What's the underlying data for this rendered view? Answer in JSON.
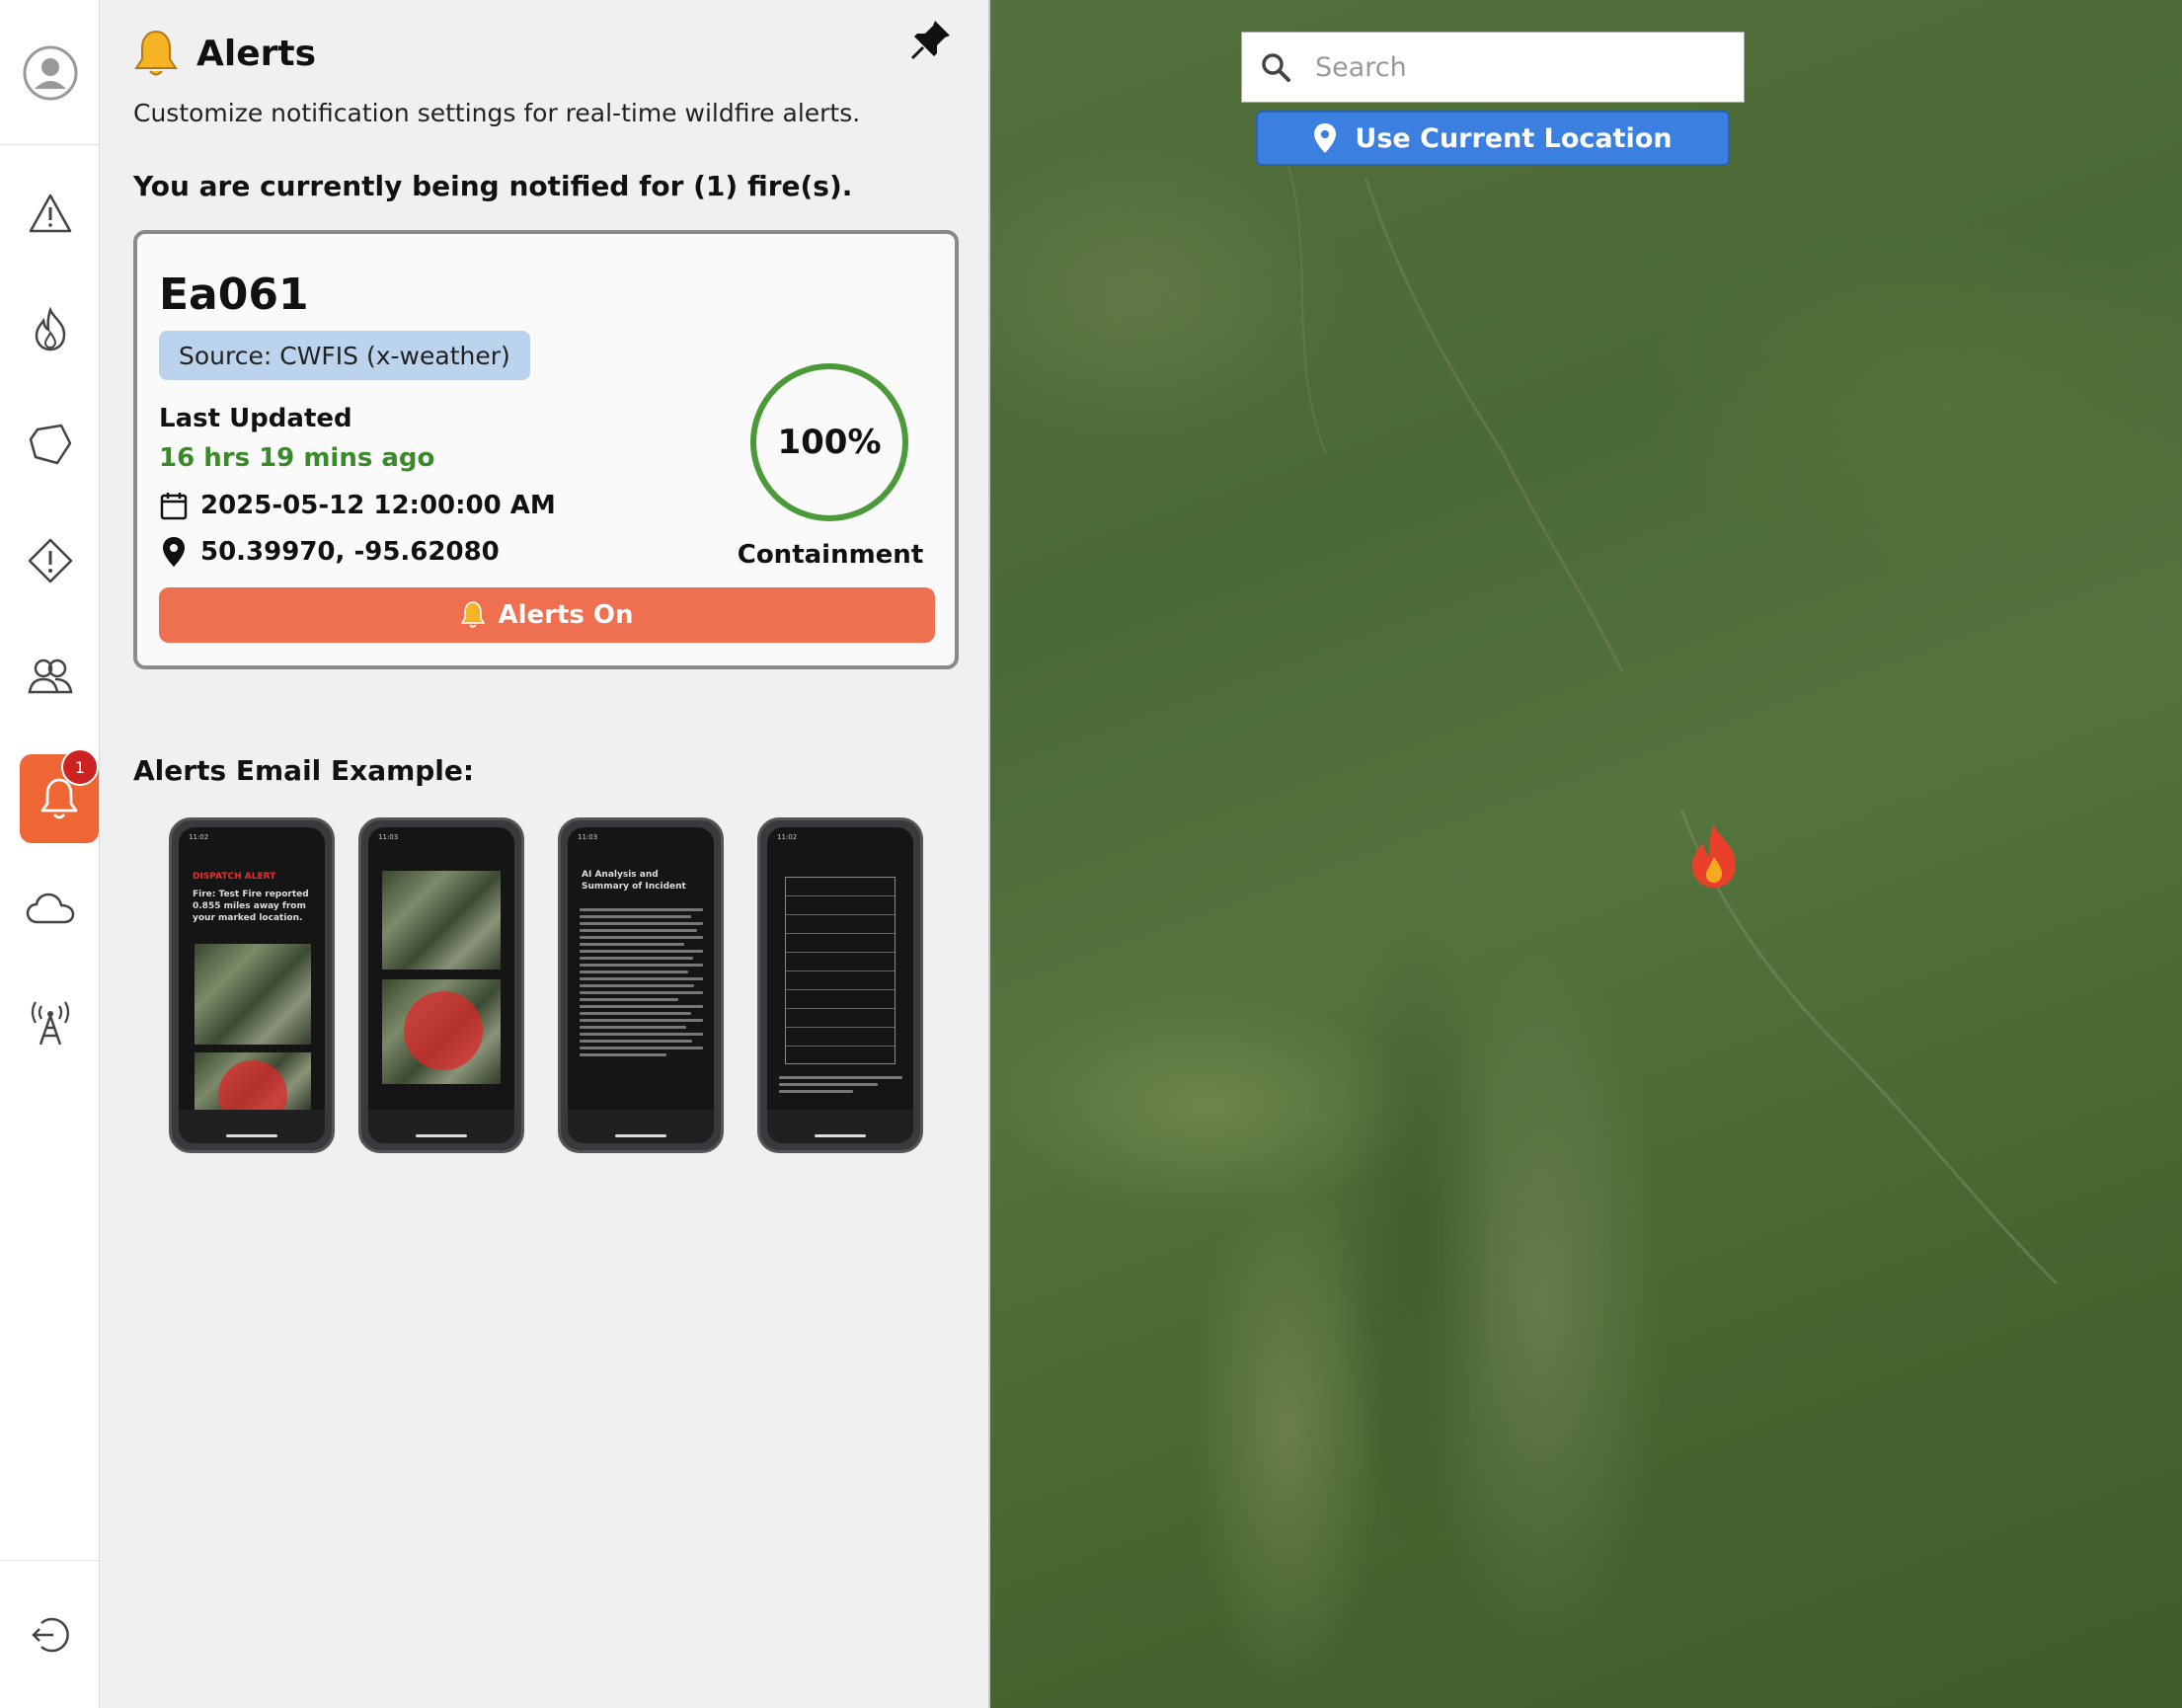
{
  "panel": {
    "title": "Alerts",
    "subtitle": "Customize notification settings for real-time wildfire alerts.",
    "notified_text": "You are currently being notified for (1) fire(s).",
    "example_title": "Alerts Email Example:"
  },
  "fire": {
    "name": "Ea061",
    "source": "Source: CWFIS (x-weather)",
    "last_updated_label": "Last Updated",
    "last_updated_value": "16 hrs 19 mins ago",
    "date": "2025-05-12 12:00:00 AM",
    "coordinates": "50.39970, -95.62080",
    "containment_percent_text": "100%",
    "containment_value": 1.0,
    "containment_label": "Containment",
    "alerts_button": "Alerts On"
  },
  "rail": {
    "alerts_badge": "1"
  },
  "map": {
    "search_placeholder": "Search",
    "use_location_label": "Use Current Location"
  },
  "email_examples": [
    {
      "time": "11:02",
      "heading_red": "DISPATCH ALERT",
      "heading": "Fire: Test Fire reported 0.855 miles away from your marked location."
    },
    {
      "time": "11:03",
      "heading_red": "",
      "heading": ""
    },
    {
      "time": "11:03",
      "heading_red": "",
      "heading": "AI Analysis and Summary of Incident"
    },
    {
      "time": "11:02",
      "heading_red": "",
      "heading": ""
    }
  ],
  "colors": {
    "accent_orange": "#ee6633",
    "alerts_button": "#ee7050",
    "source_badge": "#bcd3ee",
    "updated_green": "#3a8a2a",
    "containment_ring": "#4a9a3a",
    "location_button": "#3b7fe0"
  },
  "icons": {
    "rail": [
      "user-icon",
      "warning-icon",
      "fire-icon",
      "perimeter-icon",
      "hazard-icon",
      "community-icon",
      "bell-icon",
      "cloud-icon",
      "tower-icon",
      "logout-icon"
    ],
    "panel": [
      "bell-icon",
      "pin-icon",
      "calendar-icon",
      "location-pin-icon"
    ],
    "map": [
      "search-icon",
      "location-pin-icon",
      "fire-marker-icon"
    ]
  }
}
